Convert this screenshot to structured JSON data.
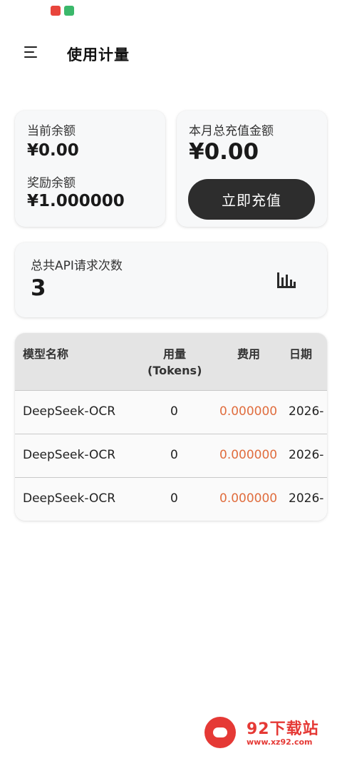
{
  "header": {
    "title": "使用计量",
    "menu_icon": "menu-icon"
  },
  "balance_card": {
    "balance_label": "当前余额",
    "balance_value": "¥0.00",
    "reward_label": "奖励余额",
    "reward_value": "¥1.000000"
  },
  "recharge_card": {
    "label": "本月总充值金额",
    "value": "¥0.00",
    "button_label": "立即充值"
  },
  "requests_card": {
    "label": "总共API请求次数",
    "value": "3",
    "icon": "bar-chart-icon"
  },
  "table": {
    "headers": {
      "model": "模型名称",
      "usage": "用量\n(Tokens)",
      "usage_line1": "用量",
      "usage_line2": "(Tokens)",
      "cost": "费用",
      "date": "日期"
    },
    "rows": [
      {
        "model": "DeepSeek-OCR",
        "usage": "0",
        "cost": "0.000000",
        "date": "2026-"
      },
      {
        "model": "DeepSeek-OCR",
        "usage": "0",
        "cost": "0.000000",
        "date": "2026-"
      },
      {
        "model": "DeepSeek-OCR",
        "usage": "0",
        "cost": "0.000000",
        "date": "2026-"
      }
    ]
  },
  "watermark": {
    "title": "92下载站",
    "url": "www.xz92.com"
  },
  "colors": {
    "cost_text": "#e06d3e",
    "button_bg": "#2d2d2d",
    "card_bg": "#f7f8f9",
    "table_header_bg": "#e4e4e4",
    "watermark_red": "#e53935"
  }
}
